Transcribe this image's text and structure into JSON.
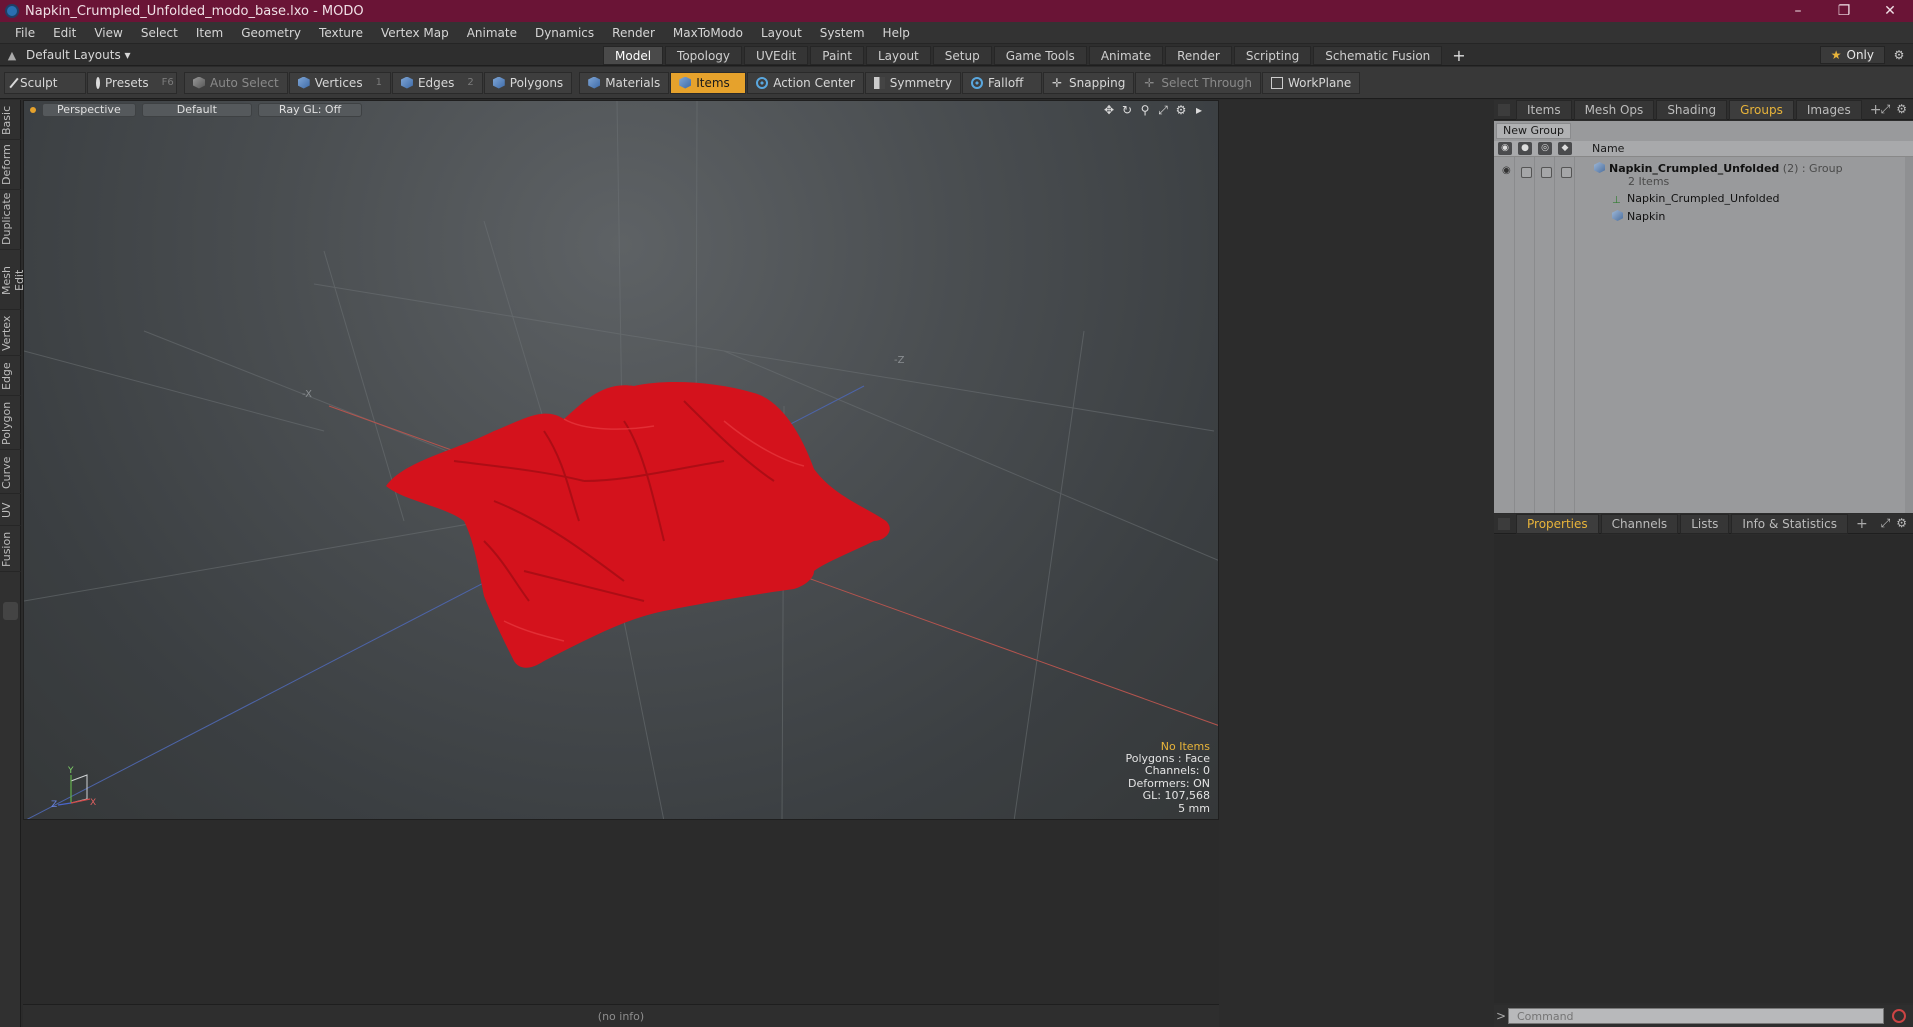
{
  "window": {
    "title": "Napkin_Crumpled_Unfolded_modo_base.lxo - MODO",
    "minimize": "–",
    "restore": "❐",
    "close": "✕"
  },
  "menu": [
    "File",
    "Edit",
    "View",
    "Select",
    "Item",
    "Geometry",
    "Texture",
    "Vertex Map",
    "Animate",
    "Dynamics",
    "Render",
    "MaxToModo",
    "Layout",
    "System",
    "Help"
  ],
  "layoutbar": {
    "layouts_label": "Default Layouts ▾",
    "tabs": [
      "Model",
      "Topology",
      "UVEdit",
      "Paint",
      "Layout",
      "Setup",
      "Game Tools",
      "Animate",
      "Render",
      "Scripting",
      "Schematic Fusion"
    ],
    "active_tab": "Model",
    "plus": "+",
    "only_label": "Only"
  },
  "toolbar": {
    "sculpt": "Sculpt",
    "presets": "Presets",
    "presets_key": "F6",
    "auto_select": "Auto Select",
    "vertices": "Vertices",
    "vertices_key": "1",
    "edges": "Edges",
    "edges_key": "2",
    "polygons": "Polygons",
    "materials": "Materials",
    "items": "Items",
    "action_center": "Action Center",
    "symmetry": "Symmetry",
    "falloff": "Falloff",
    "snapping": "Snapping",
    "select_through": "Select Through",
    "workplane": "WorkPlane"
  },
  "left_tabs": [
    "Basic",
    "Deform",
    "Duplicate",
    "Mesh Edit",
    "Vertex",
    "Edge",
    "Polygon",
    "Curve",
    "UV",
    "Fusion"
  ],
  "viewport": {
    "view_mode": "Perspective",
    "shading": "Default",
    "raygl": "Ray GL: Off",
    "axis_x": "-X",
    "axis_z": "-Z",
    "gizmo_y": "Y",
    "gizmo_z": "Z",
    "gizmo_x": "X",
    "mesh_color": "#d4121c",
    "info": {
      "selection": "No Items",
      "polygons": "Polygons : Face",
      "channels": "Channels: 0",
      "deformers": "Deformers: ON",
      "gl": "GL: 107,568",
      "unit": "5 mm"
    }
  },
  "status": "(no info)",
  "top_panel": {
    "tabs": [
      "Items",
      "Mesh Ops",
      "Shading",
      "Groups",
      "Images"
    ],
    "active_tab": "Groups",
    "new_group": "New Group",
    "name_header": "Name",
    "group_name": "Napkin_Crumpled_Unfolded",
    "group_suffix": "(2) : Group",
    "group_count": "2 Items",
    "children": [
      "Napkin_Crumpled_Unfolded",
      "Napkin"
    ]
  },
  "bottom_panel": {
    "tabs": [
      "Properties",
      "Channels",
      "Lists",
      "Info & Statistics"
    ],
    "active_tab": "Properties"
  },
  "command": {
    "placeholder": "Command",
    "prompt": ">"
  }
}
